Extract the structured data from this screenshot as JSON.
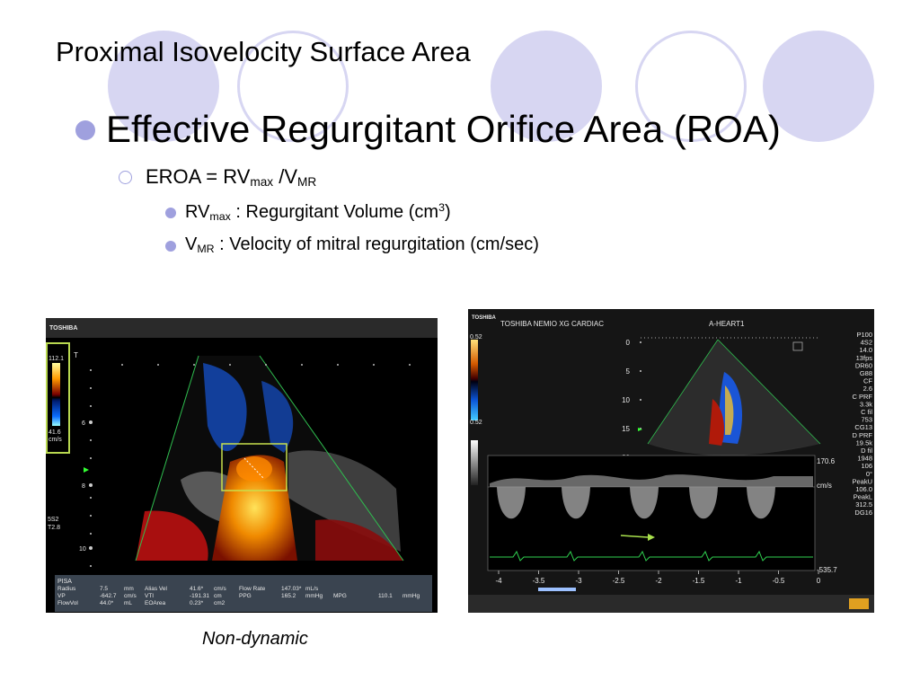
{
  "slide": {
    "title": "Proximal Isovelocity Surface Area",
    "bullet1": "Effective Regurgitant Orifice Area (ROA)",
    "bullet2": {
      "prefix": "EROA = RV",
      "sub1": "max",
      "mid": " /V",
      "sub2": "MR"
    },
    "bullet3": {
      "prefix": "RV",
      "sub": "max",
      "text": " : Regurgitant Volume (cm",
      "sup": "3",
      "suffix": ")"
    },
    "bullet4": {
      "prefix": "V",
      "sub": "MR",
      "text": " : Velocity of mitral regurgitation (cm/sec)"
    },
    "caption": "Non-dynamic"
  },
  "image_left": {
    "brand": "TOSHIBA",
    "scale_top": "112.1",
    "scale_bottom": "41.6",
    "scale_unit": "cm/s",
    "marker_t": "T",
    "probe": "5S2",
    "probe_sub": "T2.8",
    "depth_6": "6",
    "depth_8": "8",
    "depth_10": "10",
    "pisa_title": "PISA",
    "pisa_rows": [
      [
        "Radius",
        "7.5",
        "mm",
        "Alias Vel",
        "41.6*",
        "cm/s",
        "Flow Rate",
        "147.03*",
        "mL/s",
        "",
        "",
        ""
      ],
      [
        "VP",
        "-642.7",
        "cm/s",
        "VTI",
        "-191.31",
        "cm",
        "PPG",
        "165.2",
        "mmHg",
        "MPG",
        "110.1",
        "mmHg"
      ],
      [
        "FlowVol",
        "44.0*",
        "mL",
        "EOArea",
        "0.23*",
        "cm2",
        "",
        "",
        "",
        "",
        "",
        ""
      ]
    ]
  },
  "image_right": {
    "brand": "TOSHIBA",
    "header": "TOSHIBA NEMIO XG CARDIAC",
    "patient": "A-HEART1",
    "scale_top": "0.52",
    "scale_bottom": "0.52",
    "depth_ticks": [
      "0",
      "5",
      "10",
      "15",
      "20"
    ],
    "params": [
      "P100",
      "4S2",
      "14.0",
      "13fps",
      "DR60",
      "G88",
      "CF",
      "2.6",
      "C PRF",
      "3.3k",
      "C fil",
      "753",
      "CG13",
      "D PRF",
      "19.5k",
      "D fil",
      "1948",
      "106",
      "0°",
      "PeakU",
      "106.0",
      "PeakL",
      "312.5",
      "DG16"
    ],
    "doppler_top": "170.6",
    "doppler_unit": "cm/s",
    "doppler_bottom": "-535.7",
    "time_ticks": [
      "-4",
      "-3.5",
      "-3",
      "-2.5",
      "-2",
      "-1.5",
      "-1",
      "-0.5",
      "0"
    ]
  }
}
